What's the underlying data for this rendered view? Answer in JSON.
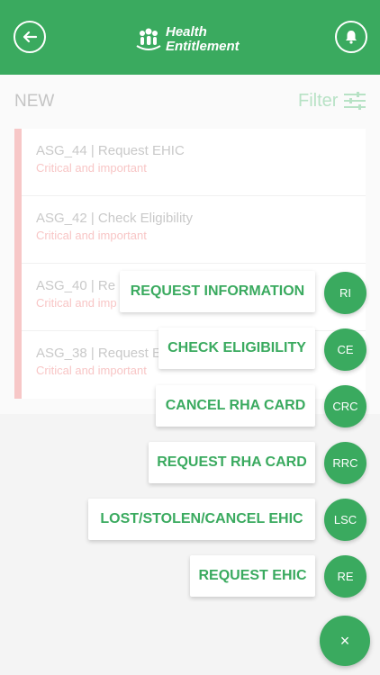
{
  "header": {
    "logo_line1": "Health",
    "logo_line2": "Entitlement",
    "back_icon": "arrow-left-icon",
    "bell_icon": "bell-icon"
  },
  "section": {
    "title": "NEW",
    "filter_label": "Filter"
  },
  "requests": [
    {
      "title": "ASG_44 | Request EHIC",
      "priority": "Critical and important"
    },
    {
      "title": "ASG_42 | Check Eligibility",
      "priority": "Critical and important"
    },
    {
      "title": "ASG_40 | Re",
      "priority": "Critical and imp"
    },
    {
      "title": "ASG_38 | Request E",
      "priority": "Critical and important"
    }
  ],
  "actions": [
    {
      "label": "REQUEST INFORMATION",
      "abbr": "RI"
    },
    {
      "label": "CHECK ELIGIBILITY",
      "abbr": "CE"
    },
    {
      "label": "CANCEL RHA CARD",
      "abbr": "CRC"
    },
    {
      "label": "REQUEST RHA CARD",
      "abbr": "RRC"
    },
    {
      "label": "LOST/STOLEN/CANCEL EHIC",
      "abbr": "LSC"
    },
    {
      "label": "REQUEST EHIC",
      "abbr": "RE"
    }
  ],
  "fab": {
    "label": "×"
  },
  "colors": {
    "primary": "#3aaa5f",
    "accent_bar": "#f7c7c7",
    "priority_text": "#f8c6c6"
  }
}
